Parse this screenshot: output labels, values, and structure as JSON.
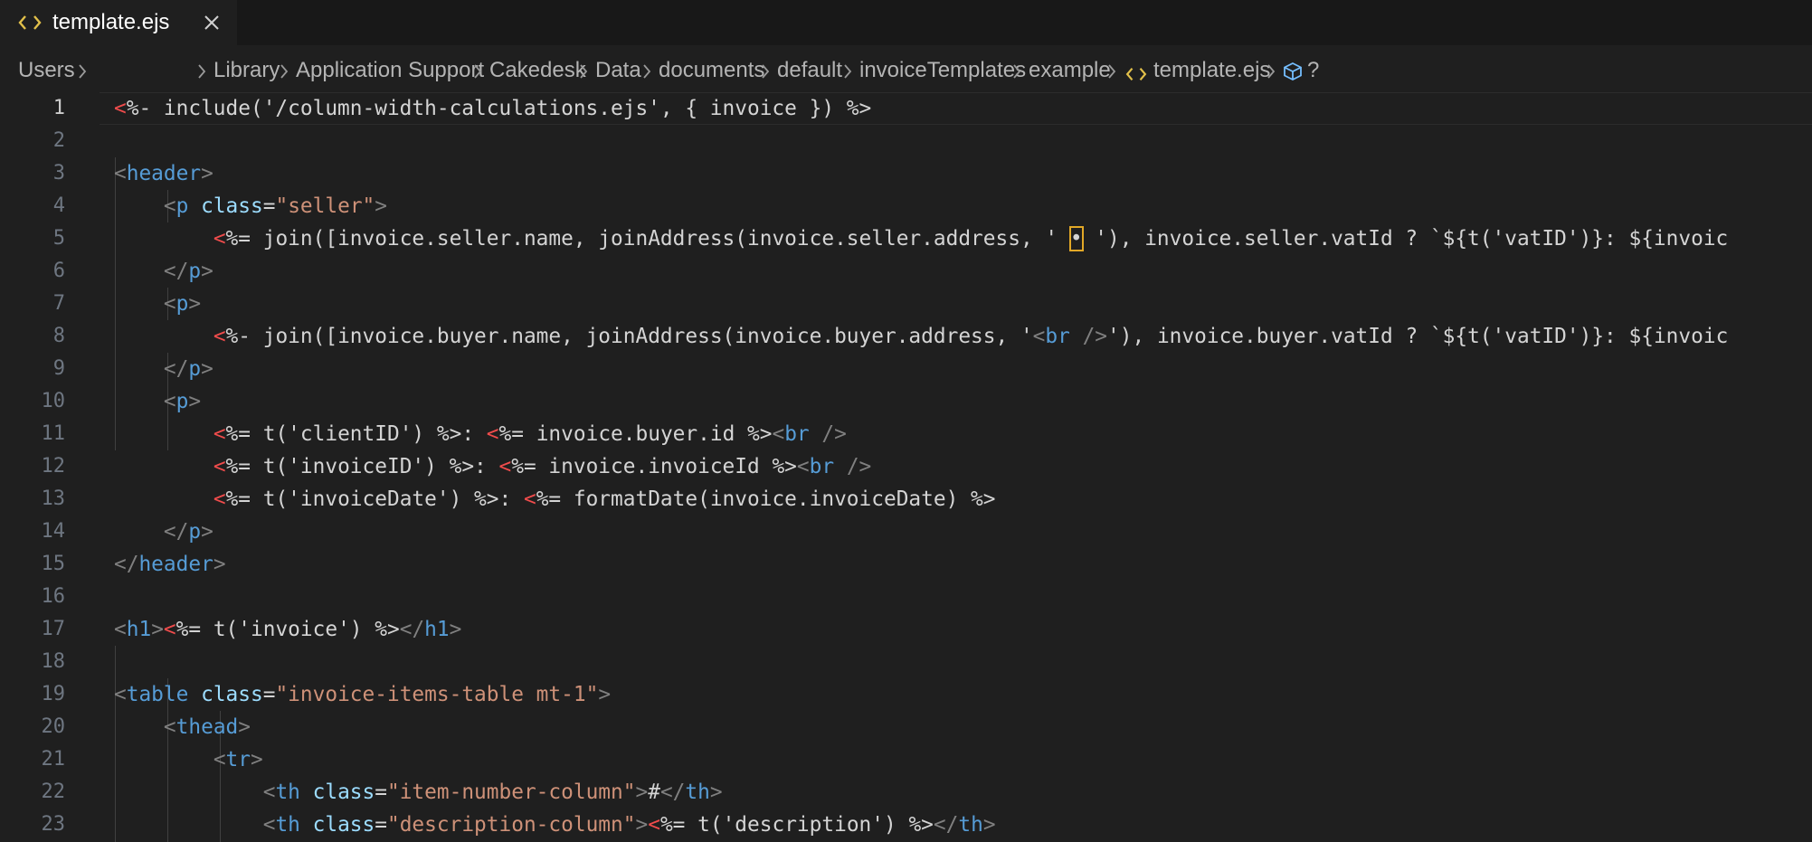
{
  "tab": {
    "title": "template.ejs",
    "icon": "code-icon",
    "close_icon": "close-icon",
    "icon_color": "#e2c04a"
  },
  "breadcrumb": {
    "items": [
      "Users",
      "Library",
      "Application Support",
      "Cakedesk",
      "Data",
      "documents",
      "default",
      "invoiceTemplates",
      "example",
      "template.ejs"
    ],
    "trailing_symbol": "?",
    "file_icon": "code-icon",
    "symbol_icon": "cube-icon"
  },
  "editor": {
    "active_line": 1,
    "line_numbers": [
      "1",
      "2",
      "3",
      "4",
      "5",
      "6",
      "7",
      "8",
      "9",
      "10",
      "11",
      "12",
      "13",
      "14",
      "15",
      "16",
      "17",
      "18",
      "19",
      "20",
      "21",
      "22",
      "23"
    ],
    "lines": [
      [
        [
          "ejs-open",
          "<"
        ],
        [
          "ejs",
          "%- include('/column-width-calculations.ejs', { invoice }) %>"
        ]
      ],
      [],
      [
        [
          "ang",
          "<"
        ],
        [
          "tag",
          "header"
        ],
        [
          "ang",
          ">"
        ]
      ],
      [
        [
          "text",
          "    "
        ],
        [
          "ang",
          "<"
        ],
        [
          "tag",
          "p"
        ],
        [
          "text",
          " "
        ],
        [
          "attr",
          "class"
        ],
        [
          "text",
          "="
        ],
        [
          "str",
          "\"seller\""
        ],
        [
          "ang",
          ">"
        ]
      ],
      [
        [
          "text",
          "        "
        ],
        [
          "ejs-open",
          "<"
        ],
        [
          "ejs",
          "%= join([invoice.seller.name, joinAddress(invoice.seller.address, ' "
        ],
        [
          "ejs",
          "•"
        ],
        [
          "ejs",
          " '), invoice.seller.vatId ? `${t('vatID')}: ${invoic"
        ]
      ],
      [
        [
          "text",
          "    "
        ],
        [
          "ang",
          "</"
        ],
        [
          "tag",
          "p"
        ],
        [
          "ang",
          ">"
        ]
      ],
      [
        [
          "text",
          "    "
        ],
        [
          "ang",
          "<"
        ],
        [
          "tag",
          "p"
        ],
        [
          "ang",
          ">"
        ]
      ],
      [
        [
          "text",
          "        "
        ],
        [
          "ejs-open",
          "<"
        ],
        [
          "ejs",
          "%- join([invoice.buyer.name, joinAddress(invoice.buyer.address, '"
        ],
        [
          "ang",
          "<"
        ],
        [
          "tag",
          "br"
        ],
        [
          "ang",
          " />"
        ],
        [
          "ejs",
          "'), invoice.buyer.vatId ? `${t('vatID')}: ${invoic"
        ]
      ],
      [
        [
          "text",
          "    "
        ],
        [
          "ang",
          "</"
        ],
        [
          "tag",
          "p"
        ],
        [
          "ang",
          ">"
        ]
      ],
      [
        [
          "text",
          "    "
        ],
        [
          "ang",
          "<"
        ],
        [
          "tag",
          "p"
        ],
        [
          "ang",
          ">"
        ]
      ],
      [
        [
          "text",
          "        "
        ],
        [
          "ejs-open",
          "<"
        ],
        [
          "ejs",
          "%= t('clientID') %>: "
        ],
        [
          "ejs-open",
          "<"
        ],
        [
          "ejs",
          "%= invoice.buyer.id %>"
        ],
        [
          "ang",
          "<"
        ],
        [
          "tag",
          "br"
        ],
        [
          "ang",
          " />"
        ]
      ],
      [
        [
          "text",
          "        "
        ],
        [
          "ejs-open",
          "<"
        ],
        [
          "ejs",
          "%= t('invoiceID') %>: "
        ],
        [
          "ejs-open",
          "<"
        ],
        [
          "ejs",
          "%= invoice.invoiceId %>"
        ],
        [
          "ang",
          "<"
        ],
        [
          "tag",
          "br"
        ],
        [
          "ang",
          " />"
        ]
      ],
      [
        [
          "text",
          "        "
        ],
        [
          "ejs-open",
          "<"
        ],
        [
          "ejs",
          "%= t('invoiceDate') %>: "
        ],
        [
          "ejs-open",
          "<"
        ],
        [
          "ejs",
          "%= formatDate(invoice.invoiceDate) %>"
        ]
      ],
      [
        [
          "text",
          "    "
        ],
        [
          "ang",
          "</"
        ],
        [
          "tag",
          "p"
        ],
        [
          "ang",
          ">"
        ]
      ],
      [
        [
          "ang",
          "</"
        ],
        [
          "tag",
          "header"
        ],
        [
          "ang",
          ">"
        ]
      ],
      [],
      [
        [
          "ang",
          "<"
        ],
        [
          "tag",
          "h1"
        ],
        [
          "ang",
          ">"
        ],
        [
          "ejs-open",
          "<"
        ],
        [
          "ejs",
          "%= t('invoice') %>"
        ],
        [
          "ang",
          "</"
        ],
        [
          "tag",
          "h1"
        ],
        [
          "ang",
          ">"
        ]
      ],
      [],
      [
        [
          "ang",
          "<"
        ],
        [
          "tag",
          "table"
        ],
        [
          "text",
          " "
        ],
        [
          "attr",
          "class"
        ],
        [
          "text",
          "="
        ],
        [
          "str",
          "\"invoice-items-table mt-1\""
        ],
        [
          "ang",
          ">"
        ]
      ],
      [
        [
          "text",
          "    "
        ],
        [
          "ang",
          "<"
        ],
        [
          "tag",
          "thead"
        ],
        [
          "ang",
          ">"
        ]
      ],
      [
        [
          "text",
          "        "
        ],
        [
          "ang",
          "<"
        ],
        [
          "tag",
          "tr"
        ],
        [
          "ang",
          ">"
        ]
      ],
      [
        [
          "text",
          "            "
        ],
        [
          "ang",
          "<"
        ],
        [
          "tag",
          "th"
        ],
        [
          "text",
          " "
        ],
        [
          "attr",
          "class"
        ],
        [
          "text",
          "="
        ],
        [
          "str",
          "\"item-number-column\""
        ],
        [
          "ang",
          ">"
        ],
        [
          "text",
          "#"
        ],
        [
          "ang",
          "</"
        ],
        [
          "tag",
          "th"
        ],
        [
          "ang",
          ">"
        ]
      ],
      [
        [
          "text",
          "            "
        ],
        [
          "ang",
          "<"
        ],
        [
          "tag",
          "th"
        ],
        [
          "text",
          " "
        ],
        [
          "attr",
          "class"
        ],
        [
          "text",
          "="
        ],
        [
          "str",
          "\"description-column\""
        ],
        [
          "ang",
          ">"
        ],
        [
          "ejs-open",
          "<"
        ],
        [
          "ejs",
          "%= t('description') %>"
        ],
        [
          "ang",
          "</"
        ],
        [
          "tag",
          "th"
        ],
        [
          "ang",
          ">"
        ]
      ]
    ]
  }
}
